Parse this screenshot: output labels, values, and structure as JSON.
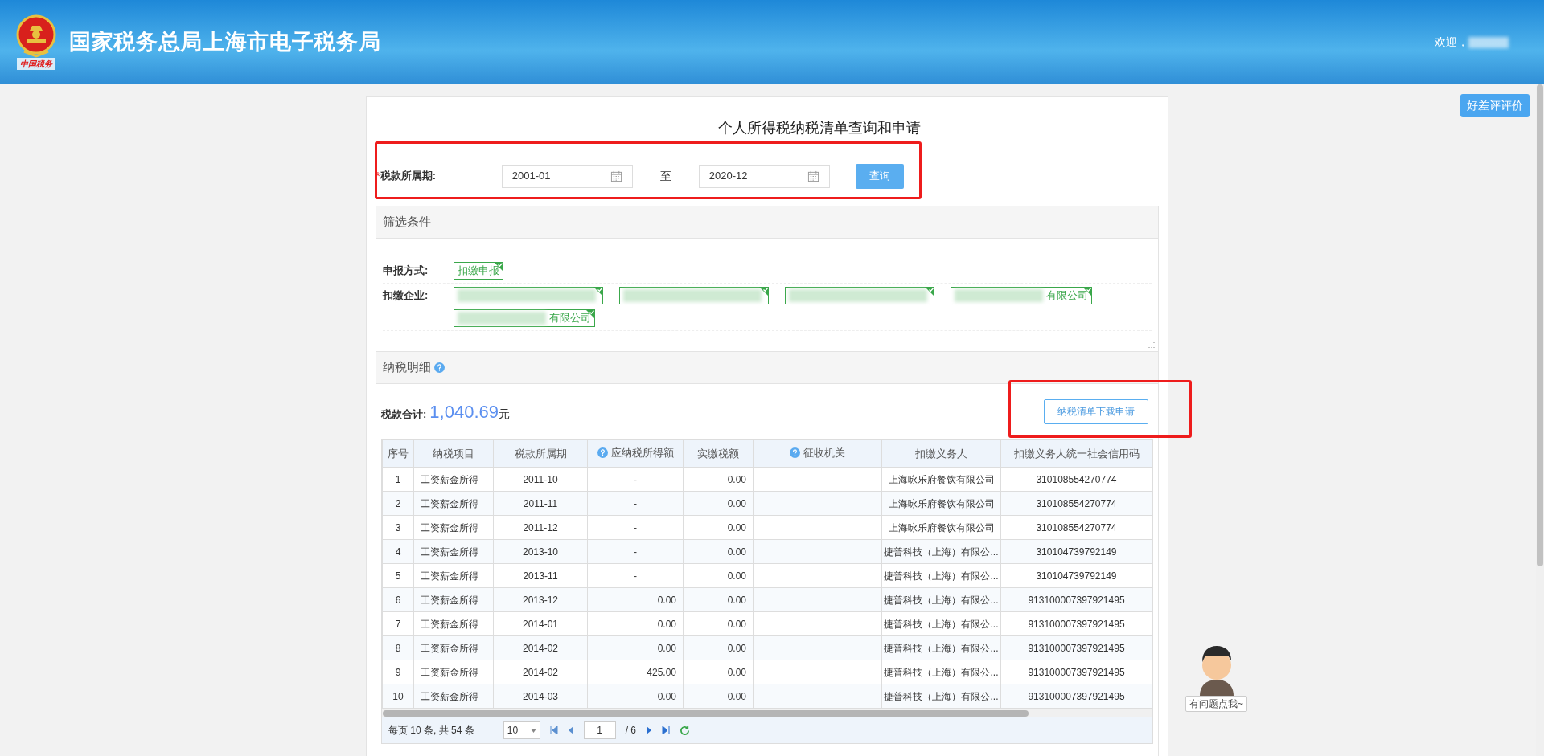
{
  "header": {
    "logo_caption": "中国税务",
    "title": "国家税务总局上海市电子税务局",
    "welcome": "欢迎，",
    "user_blurred": true
  },
  "feedback_button": "好差评评价",
  "page_title": "个人所得税纳税清单查询和申请",
  "query": {
    "required_mark": "*",
    "label": "税款所属期:",
    "from": "2001-01",
    "separator": "至",
    "to": "2020-12",
    "button": "查询"
  },
  "filter": {
    "title": "筛选条件",
    "groups": [
      {
        "label": "申报方式:",
        "tags": [
          {
            "text": "扣缴申报",
            "blurred": false,
            "selected": true
          }
        ]
      },
      {
        "label": "扣缴企业:",
        "tags": [
          {
            "blurred": true,
            "selected": true
          },
          {
            "blurred": true,
            "selected": true
          },
          {
            "blurred": true,
            "selected": true
          },
          {
            "text": "有限公司",
            "blurred": true,
            "selected": true
          },
          {
            "text": "有限公司",
            "blurred": true,
            "selected": true
          }
        ]
      }
    ]
  },
  "detail": {
    "title": "纳税明细",
    "total_label": "税款合计:",
    "total_value": "1,040.69",
    "total_unit": "元",
    "download_button": "纳税清单下载申请"
  },
  "table": {
    "columns": [
      {
        "label": "序号",
        "help": false
      },
      {
        "label": "纳税项目",
        "help": false
      },
      {
        "label": "税款所属期",
        "help": false
      },
      {
        "label": "应纳税所得额",
        "help": true
      },
      {
        "label": "实缴税额",
        "help": false
      },
      {
        "label": "征收机关",
        "help": true
      },
      {
        "label": "扣缴义务人",
        "help": false
      },
      {
        "label": "扣缴义务人统一社会信用码",
        "help": false
      }
    ],
    "rows": [
      [
        "1",
        "工资薪金所得",
        "2011-10",
        "-",
        "0.00",
        "",
        "上海咏乐府餐饮有限公司",
        "310108554270774"
      ],
      [
        "2",
        "工资薪金所得",
        "2011-11",
        "-",
        "0.00",
        "",
        "上海咏乐府餐饮有限公司",
        "310108554270774"
      ],
      [
        "3",
        "工资薪金所得",
        "2011-12",
        "-",
        "0.00",
        "",
        "上海咏乐府餐饮有限公司",
        "310108554270774"
      ],
      [
        "4",
        "工资薪金所得",
        "2013-10",
        "-",
        "0.00",
        "",
        "捷普科技（上海）有限公...",
        "310104739792149"
      ],
      [
        "5",
        "工资薪金所得",
        "2013-11",
        "-",
        "0.00",
        "",
        "捷普科技（上海）有限公...",
        "310104739792149"
      ],
      [
        "6",
        "工资薪金所得",
        "2013-12",
        "0.00",
        "0.00",
        "",
        "捷普科技（上海）有限公...",
        "913100007397921495"
      ],
      [
        "7",
        "工资薪金所得",
        "2014-01",
        "0.00",
        "0.00",
        "",
        "捷普科技（上海）有限公...",
        "913100007397921495"
      ],
      [
        "8",
        "工资薪金所得",
        "2014-02",
        "0.00",
        "0.00",
        "",
        "捷普科技（上海）有限公...",
        "913100007397921495"
      ],
      [
        "9",
        "工资薪金所得",
        "2014-02",
        "425.00",
        "0.00",
        "",
        "捷普科技（上海）有限公...",
        "913100007397921495"
      ],
      [
        "10",
        "工资薪金所得",
        "2014-03",
        "0.00",
        "0.00",
        "",
        "捷普科技（上海）有限公...",
        "913100007397921495"
      ]
    ]
  },
  "pagination": {
    "summary": "每页 10 条, 共 54 条",
    "page_size": "10",
    "page": "1",
    "total_pages": "/ 6"
  },
  "chat": {
    "label": "有问题点我~"
  }
}
